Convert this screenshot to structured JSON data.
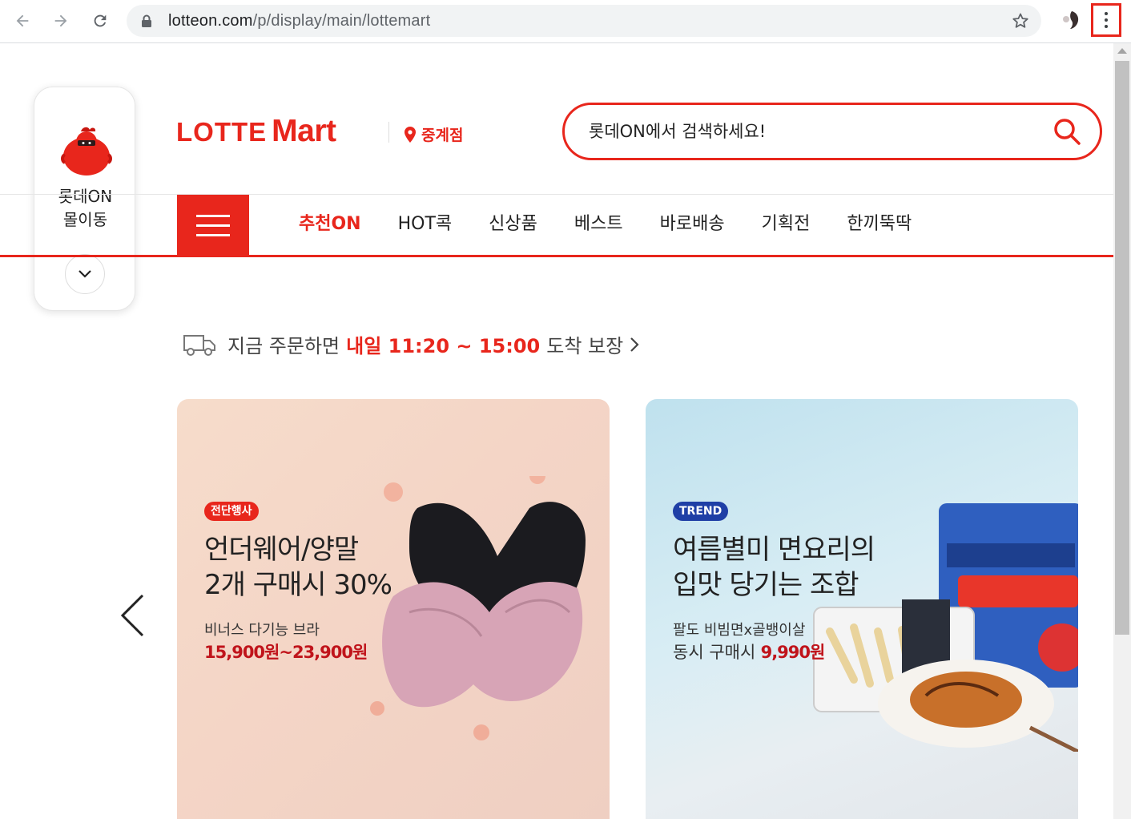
{
  "browser": {
    "url_host": "lotteon.com",
    "url_path": "/p/display/main/lottemart"
  },
  "widget": {
    "label": "롯데ON\n몰이동"
  },
  "logo": {
    "lotte": "LOTTE",
    "mart": "Mart"
  },
  "store": {
    "name": "중계점"
  },
  "search": {
    "placeholder": "롯데ON에서 검색하세요!"
  },
  "tabs": [
    {
      "label": "추천ON",
      "active": true
    },
    {
      "label": "HOT콕"
    },
    {
      "label": "신상품"
    },
    {
      "label": "베스트"
    },
    {
      "label": "바로배송"
    },
    {
      "label": "기획전"
    },
    {
      "label": "한끼뚝딱"
    }
  ],
  "delivery": {
    "prefix": "지금 주문하면",
    "highlight": "내일 11:20 ~ 15:00",
    "suffix": "도착 보장"
  },
  "banners": [
    {
      "badge": "전단행사",
      "title": "언더웨어/양말\n2개 구매시 30%",
      "subtitle": "비너스 다기능 브라",
      "price": "15,900원~23,900원"
    },
    {
      "badge": "TREND",
      "title": "여름별미 면요리의\n입맛 당기는 조합",
      "subtitle": "팔도 비빔면x골뱅이살",
      "price_prefix": "동시 구매시",
      "price": "9,990원"
    }
  ],
  "colors": {
    "accent": "#e8261c"
  }
}
